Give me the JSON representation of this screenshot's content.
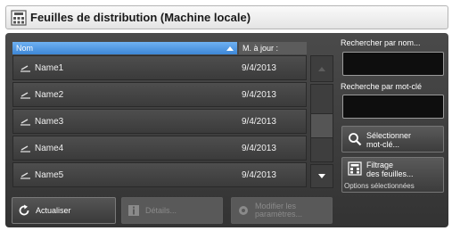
{
  "window": {
    "title": "Feuilles de distribution (Machine locale)"
  },
  "table": {
    "col_name": "Nom",
    "col_date": "M. à jour :",
    "rows": [
      {
        "name": "Name1",
        "date": "9/4/2013"
      },
      {
        "name": "Name2",
        "date": "9/4/2013"
      },
      {
        "name": "Name3",
        "date": "9/4/2013"
      },
      {
        "name": "Name4",
        "date": "9/4/2013"
      },
      {
        "name": "Name5",
        "date": "9/4/2013"
      }
    ]
  },
  "search": {
    "by_name_label": "Rechercher par nom...",
    "by_keyword_label": "Recherche par mot-clé"
  },
  "buttons": {
    "select_keyword_line1": "Sélectionner",
    "select_keyword_line2": "mot-clé...",
    "filter_line1": "Filtrage",
    "filter_line2": "des feuilles...",
    "filter_sub": "Options sélectionnées",
    "refresh": "Actualiser",
    "details": "Détails...",
    "modify_line1": "Modifier les",
    "modify_line2": "paramètres..."
  }
}
